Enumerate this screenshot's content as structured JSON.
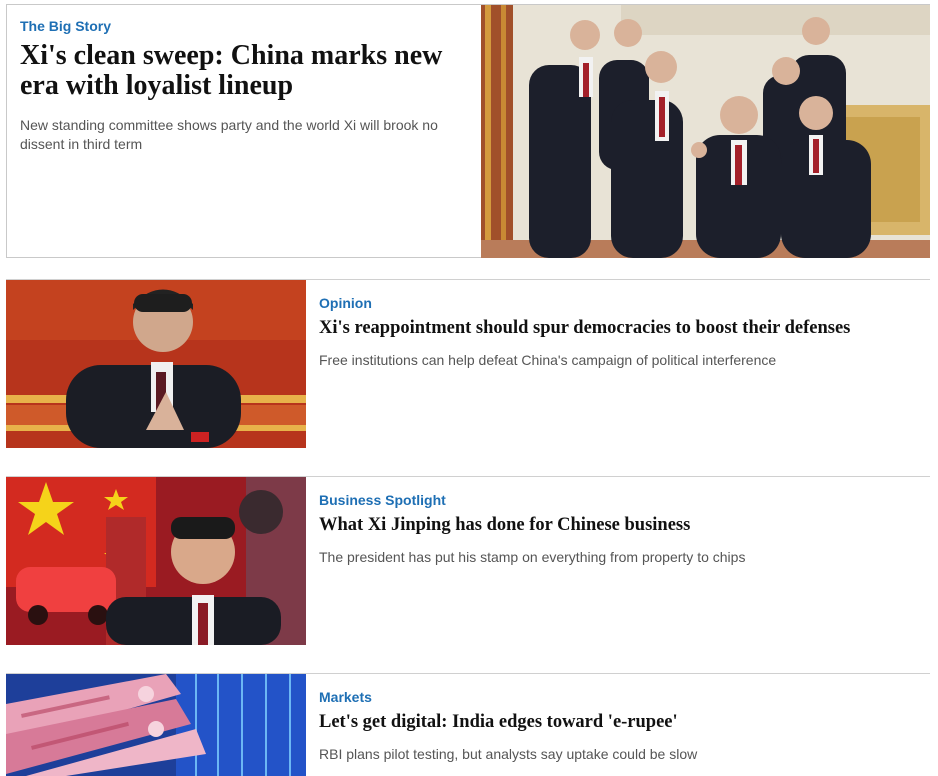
{
  "big_story": {
    "kicker": "The Big Story",
    "headline": "Xi's clean sweep: China marks new era with loyalist lineup",
    "summary": "New standing committee shows party and the world Xi will brook no dissent in third term"
  },
  "stories": [
    {
      "kicker": "Opinion",
      "headline": "Xi's reappointment should spur democracies to boost their defenses",
      "summary": "Free institutions can help defeat China's campaign of political interference"
    },
    {
      "kicker": "Business Spotlight",
      "headline": "What Xi Jinping has done for Chinese business",
      "summary": "The president has put his stamp on everything from property to chips"
    },
    {
      "kicker": "Markets",
      "headline": "Let's get digital: India edges toward 'e-rupee'",
      "summary": "RBI plans pilot testing, but analysts say uptake could be slow"
    }
  ],
  "colors": {
    "kicker": "#1e6fb4",
    "headline": "#111111",
    "summary": "#555555",
    "divider": "#d0d0d0"
  }
}
